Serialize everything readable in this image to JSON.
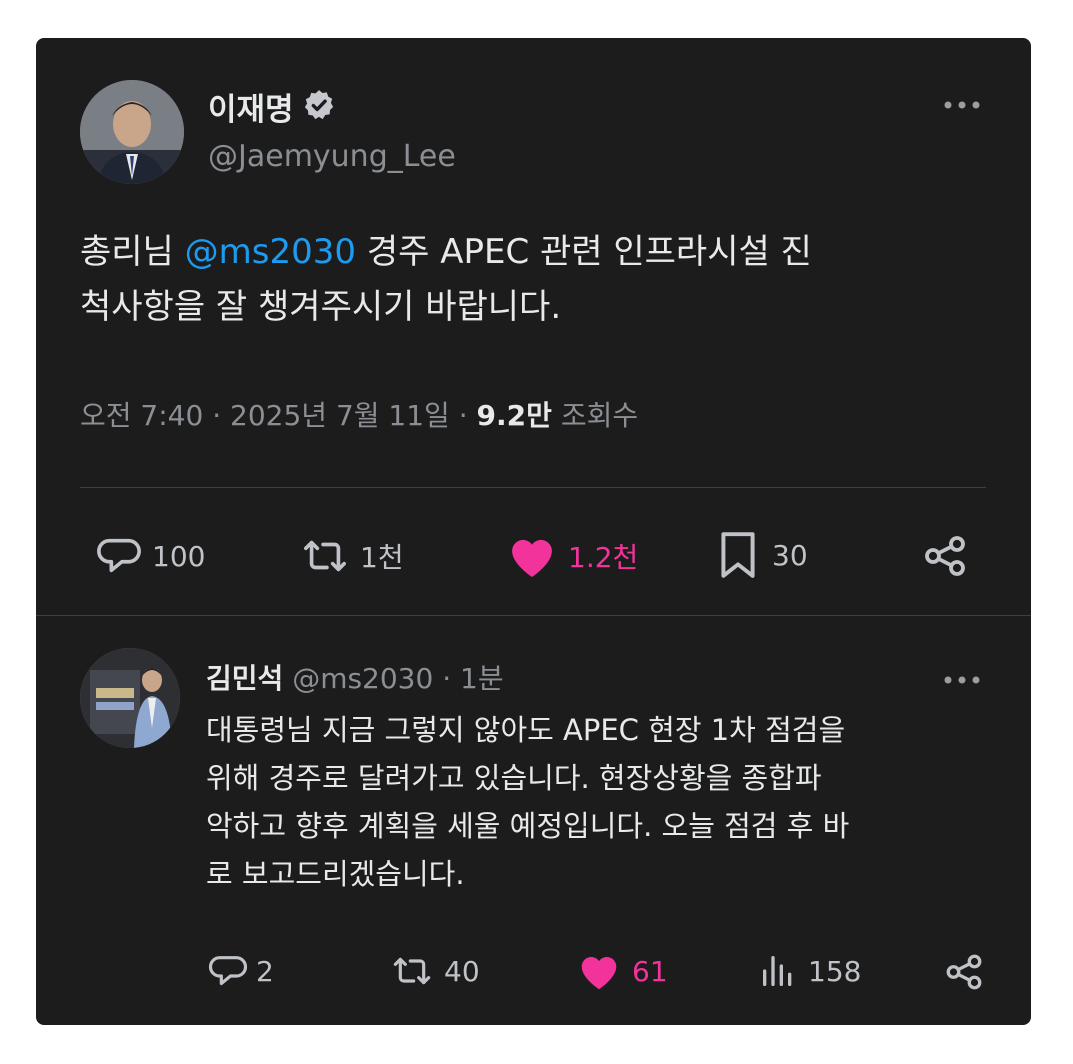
{
  "main_tweet": {
    "author_name": "이재명",
    "handle": "@Jaemyung_Lee",
    "text_prefix": "총리님 ",
    "mention": "@ms2030",
    "text_line1_rest": " 경주 APEC 관련 인프라시설 진",
    "text_line2": "척사항을 잘 챙겨주시기 바랍니다.",
    "time": "오전 7:40",
    "date": "2025년 7월 11일",
    "views_count": "9.2만",
    "views_label": "조회수",
    "sep": "·",
    "actions": {
      "replies": "100",
      "retweets": "1천",
      "likes": "1.2천",
      "bookmarks": "30"
    }
  },
  "reply_tweet": {
    "author_name": "김민석",
    "handle": "@ms2030",
    "sep": "·",
    "time": "1분",
    "lines": [
      "대통령님 지금 그렇지 않아도 APEC 현장 1차 점검을",
      "위해 경주로 달려가고 있습니다. 현장상황을 종합파",
      "악하고 향후 계획을 세울 예정입니다. 오늘 점검 후 바",
      "로 보고드리겠습니다."
    ],
    "actions": {
      "replies": "2",
      "retweets": "40",
      "likes": "61",
      "views": "158"
    }
  },
  "colors": {
    "card_bg": "#1c1c1c",
    "text": "#e7e9ea",
    "muted": "#8b8f94",
    "link": "#1d9bf0",
    "like": "#f3339c"
  },
  "icons": [
    "verified-badge-icon",
    "more-icon",
    "reply-icon",
    "retweet-icon",
    "heart-icon",
    "bookmark-icon",
    "share-icon",
    "views-icon"
  ]
}
